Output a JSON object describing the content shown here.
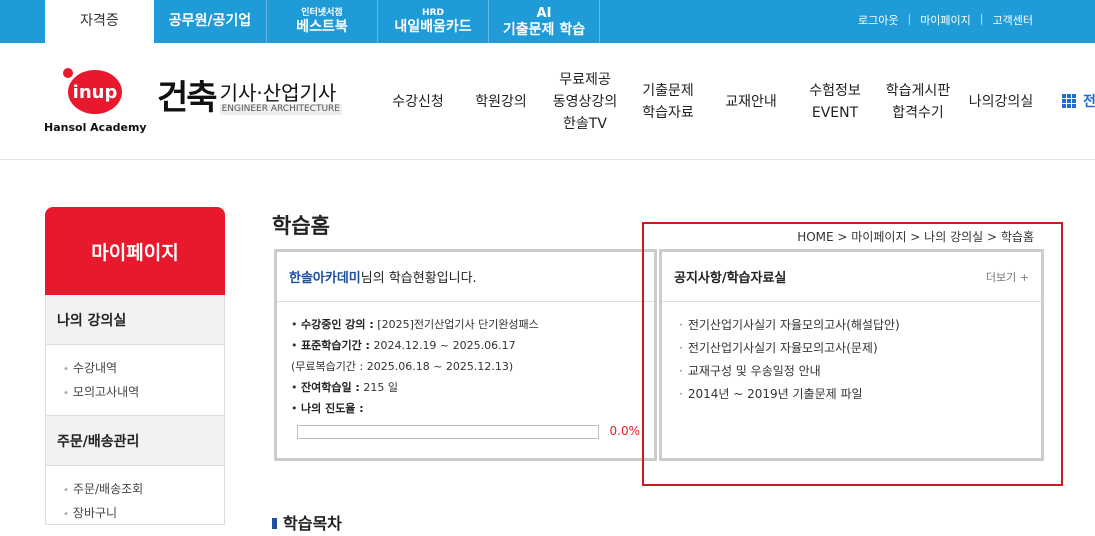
{
  "topbar": {
    "tabs": [
      {
        "big": "자격증",
        "small": ""
      },
      {
        "big": "공무원/공기업",
        "small": ""
      },
      {
        "big": "베스트북",
        "small": "인터넷서점"
      },
      {
        "big": "내일배움카드",
        "small": "HRD"
      },
      {
        "big": "기출문제 학습",
        "small": "AI"
      }
    ],
    "links": [
      "로그아웃",
      "마이페이지",
      "고객센터"
    ]
  },
  "header": {
    "logo_text": "inup",
    "logo_sub": "Hansol Academy",
    "brand_main": "건축",
    "brand_kr": "기사·산업기사",
    "brand_en": "ENGINEER ARCHITECTURE",
    "nav": [
      {
        "line1": "수강신청",
        "line2": "",
        "line3": ""
      },
      {
        "line1": "학원강의",
        "line2": "",
        "line3": ""
      },
      {
        "line1": "무료제공",
        "line2": "동영상강의",
        "line3": "한솔TV"
      },
      {
        "line1": "기출문제",
        "line2": "학습자료",
        "line3": ""
      },
      {
        "line1": "교재안내",
        "line2": "",
        "line3": ""
      },
      {
        "line1": "수험정보",
        "line2": "EVENT",
        "line3": ""
      },
      {
        "line1": "학습게시판",
        "line2": "합격수기",
        "line3": ""
      },
      {
        "line1": "나의강의실",
        "line2": "",
        "line3": ""
      }
    ],
    "more_label": "전"
  },
  "sidebar": {
    "title": "마이페이지",
    "sections": [
      {
        "title": "나의 강의실",
        "items": [
          "수강내역",
          "모의고사내역"
        ]
      },
      {
        "title": "주문/배송관리",
        "items": [
          "주문/배송조회",
          "장바구니"
        ]
      }
    ]
  },
  "main": {
    "title": "학습홈",
    "breadcrumb": "HOME > 마이페이지 > 나의 강의실 > 학습홈",
    "status": {
      "user_name": "한솔아카데미",
      "user_suffix": "님의 학습현황입니다.",
      "course_label": "수강중인 강의 :",
      "course_value": "[2025]전기산업기사 단기완성패스",
      "period_label": "표준학습기간 :",
      "period_value": "2024.12.19 ~ 2025.06.17",
      "review_period": "(무료복습기간 : 2025.06.18 ~ 2025.12.13)",
      "remaining_label": "잔여학습일 :",
      "remaining_value": "215 일",
      "progress_label": "나의 진도율 :",
      "progress_text": "0.0%",
      "progress_fraction": 0.0
    },
    "notice": {
      "title": "공지사항/학습자료실",
      "more": "더보기 +",
      "items": [
        "전기산업기사실기 자율모의고사(해설답안)",
        "전기산업기사실기 자율모의고사(문제)",
        "교재구성 및 우송일정 안내",
        "2014년 ~ 2019년 기출문제 파일"
      ]
    },
    "section2_title": "학습목차"
  }
}
